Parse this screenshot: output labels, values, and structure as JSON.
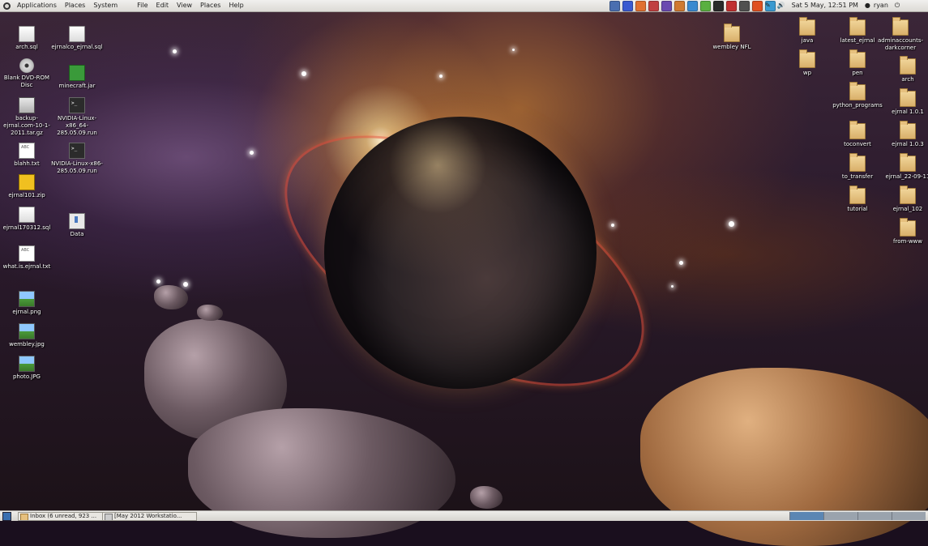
{
  "top_panel": {
    "menus": [
      "Applications",
      "Places",
      "System"
    ],
    "app_menus": [
      "File",
      "Edit",
      "View",
      "Places",
      "Help"
    ],
    "launcher_colors": [
      "#4a6fb0",
      "#3a5ad0",
      "#e07030",
      "#c04040",
      "#6a4ab0",
      "#d07a30",
      "#3a8ad0",
      "#5ab040",
      "#2a2a2a",
      "#c03030",
      "#505050",
      "#e05020",
      "#3a9ad0"
    ],
    "clock": "Sat 5 May, 12:51 PM",
    "user": "ryan"
  },
  "desktop": {
    "left_icons": [
      {
        "label": "arch.sql",
        "icon": "document-icon"
      },
      {
        "label": "Blank DVD-ROM Disc",
        "icon": "disc-icon"
      },
      {
        "label": "backup-ejrnal.com-10-1-2011.tar.gz",
        "icon": "archive-icon"
      },
      {
        "label": "blahh.txt",
        "icon": "text-file-icon"
      },
      {
        "label": "ejrnal101.zip",
        "icon": "zip-icon"
      },
      {
        "label": "ejrnal170312.sql",
        "icon": "document-icon"
      },
      {
        "label": "what.is.ejrnal.txt",
        "icon": "text-file-icon"
      },
      {
        "label": "ejrnal.png",
        "icon": "image-icon"
      },
      {
        "label": "wembley.jpg",
        "icon": "image-icon"
      },
      {
        "label": "photo.JPG",
        "icon": "image-icon"
      }
    ],
    "second_column_icons": [
      {
        "label": "ejrnalco_ejrnal.sql",
        "icon": "document-icon"
      },
      {
        "label": "minecraft.jar",
        "icon": "jar-icon"
      },
      {
        "label": "NVIDIA-Linux-x86_64-285.05.09.run",
        "icon": "terminal-icon"
      },
      {
        "label": "NVIDIA-Linux-x86-285.05.09.run",
        "icon": "terminal-icon"
      },
      {
        "label": "Data",
        "icon": "drive-icon"
      }
    ],
    "right_icons": [
      {
        "label": "wembley NFL",
        "icon": "folder-icon"
      },
      {
        "label": "java",
        "icon": "folder-icon"
      },
      {
        "label": "latest_ejrnal",
        "icon": "folder-icon"
      },
      {
        "label": "adminaccounts-darkcorner",
        "icon": "folder-icon"
      },
      {
        "label": "wp",
        "icon": "folder-icon"
      },
      {
        "label": "pen",
        "icon": "folder-icon"
      },
      {
        "label": "arch",
        "icon": "folder-icon"
      },
      {
        "label": "python_programs",
        "icon": "folder-icon"
      },
      {
        "label": "ejrnal 1.0.1",
        "icon": "folder-icon"
      },
      {
        "label": "toconvert",
        "icon": "folder-icon"
      },
      {
        "label": "ejrnal 1.0.3",
        "icon": "folder-icon"
      },
      {
        "label": "to_transfer",
        "icon": "folder-icon"
      },
      {
        "label": "ejrnal_22-09-11",
        "icon": "folder-icon"
      },
      {
        "label": "tutorial",
        "icon": "folder-icon"
      },
      {
        "label": "ejrnal_102",
        "icon": "folder-icon"
      },
      {
        "label": "from-www",
        "icon": "folder-icon"
      }
    ]
  },
  "bottom_panel": {
    "tasks": [
      "Inbox (6 unread, 923 ...",
      "[May 2012 Workstatio..."
    ],
    "workspaces": 4,
    "active_workspace": 1
  }
}
